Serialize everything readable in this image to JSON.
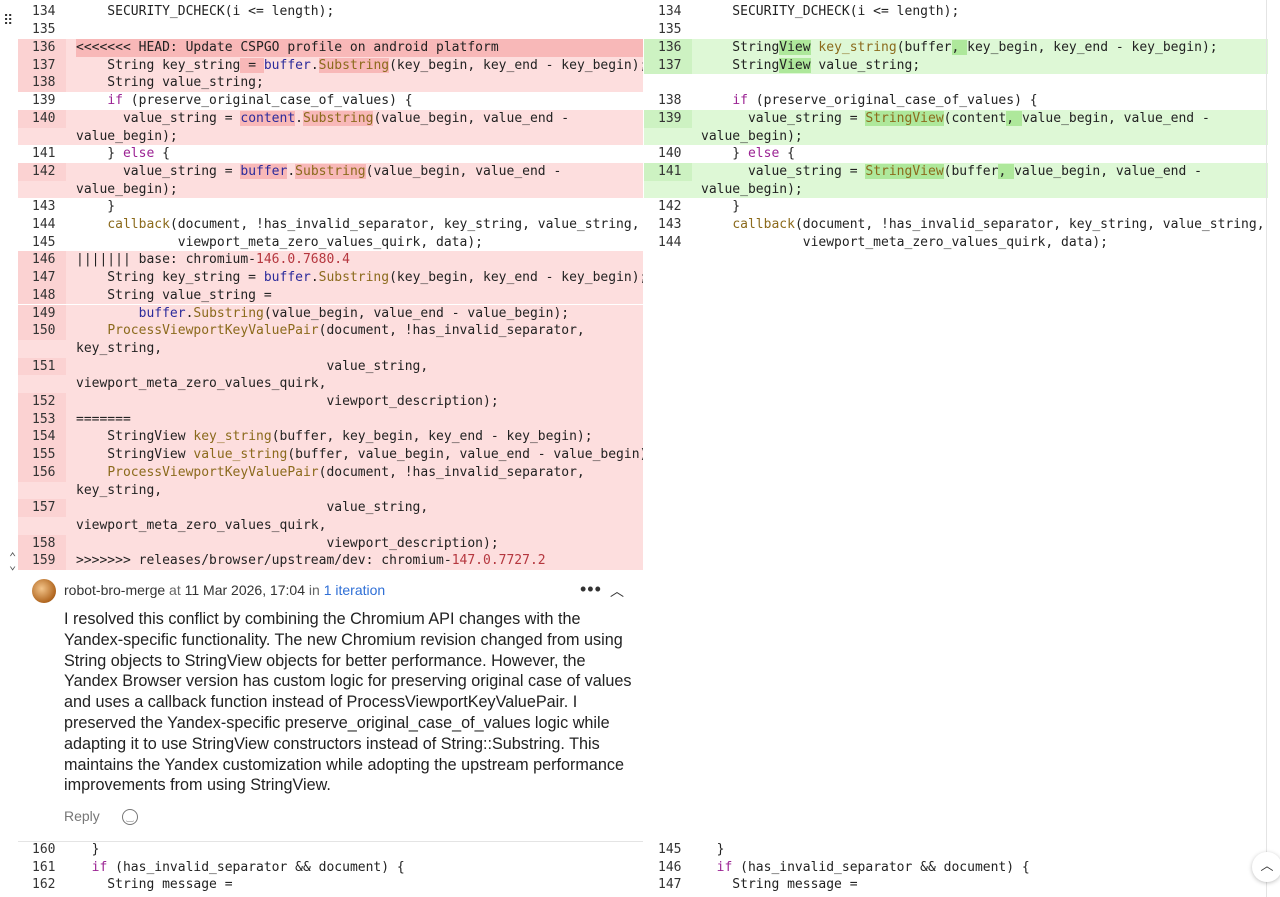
{
  "left": {
    "rows": [
      {
        "n": "134",
        "t": "    SECURITY_DCHECK(i <= length);"
      },
      {
        "n": "135",
        "t": ""
      },
      {
        "n": "136",
        "t": "<<<<<<< HEAD: Update CSPGO profile on android platform"
      },
      {
        "n": "137",
        "t": "    String key_string = buffer.Substring(key_begin, key_end - key_begin);"
      },
      {
        "n": "138",
        "t": "    String value_string;"
      },
      {
        "n": "139",
        "t": "    if (preserve_original_case_of_values) {"
      },
      {
        "n": "140",
        "t": "      value_string = content.Substring(value_begin, value_end -",
        "t2": "value_begin);"
      },
      {
        "n": "141",
        "t": "    } else {"
      },
      {
        "n": "142",
        "t": "      value_string = buffer.Substring(value_begin, value_end -",
        "t2": "value_begin);"
      },
      {
        "n": "143",
        "t": "    }"
      },
      {
        "n": "144",
        "t": "    callback(document, !has_invalid_separator, key_string, value_string,"
      },
      {
        "n": "145",
        "t": "             viewport_meta_zero_values_quirk, data);"
      },
      {
        "n": "146",
        "t": "||||||| base: chromium-146.0.7680.4"
      },
      {
        "n": "147",
        "t": "    String key_string = buffer.Substring(key_begin, key_end - key_begin);"
      },
      {
        "n": "148",
        "t": "    String value_string ="
      },
      {
        "n": "149",
        "t": "        buffer.Substring(value_begin, value_end - value_begin);"
      },
      {
        "n": "150",
        "t": "    ProcessViewportKeyValuePair(document, !has_invalid_separator,",
        "t2": "key_string,"
      },
      {
        "n": "151",
        "t": "                                value_string,",
        "t2": "viewport_meta_zero_values_quirk,"
      },
      {
        "n": "152",
        "t": "                                viewport_description);"
      },
      {
        "n": "153",
        "t": "======="
      },
      {
        "n": "154",
        "t": "    StringView key_string(buffer, key_begin, key_end - key_begin);"
      },
      {
        "n": "155",
        "t": "    StringView value_string(buffer, value_begin, value_end - value_begin);"
      },
      {
        "n": "156",
        "t": "    ProcessViewportKeyValuePair(document, !has_invalid_separator,",
        "t2": "key_string,"
      },
      {
        "n": "157",
        "t": "                                value_string,",
        "t2": "viewport_meta_zero_values_quirk,"
      },
      {
        "n": "158",
        "t": "                                viewport_description);"
      },
      {
        "n": "159",
        "t": ">>>>>>> releases/browser/upstream/dev: chromium-147.0.7727.2"
      }
    ],
    "tail": [
      {
        "n": "160",
        "t": "  }"
      },
      {
        "n": "161",
        "t": "  if (has_invalid_separator && document) {"
      },
      {
        "n": "162",
        "t": "    String message ="
      }
    ]
  },
  "right": {
    "rows": [
      {
        "n": "134",
        "t": "    SECURITY_DCHECK(i <= length);"
      },
      {
        "n": "135",
        "t": ""
      },
      {
        "n": "136",
        "t": "    StringView key_string(buffer, key_begin, key_end - key_begin);"
      },
      {
        "n": "137",
        "t": "    StringView value_string;"
      },
      {
        "n": "138",
        "t": "    if (preserve_original_case_of_values) {"
      },
      {
        "n": "139",
        "t": "      value_string = StringView(content, value_begin, value_end -",
        "t2": "value_begin);"
      },
      {
        "n": "140",
        "t": "    } else {"
      },
      {
        "n": "141",
        "t": "      value_string = StringView(buffer, value_begin, value_end -",
        "t2": "value_begin);"
      },
      {
        "n": "142",
        "t": "    }"
      },
      {
        "n": "143",
        "t": "    callback(document, !has_invalid_separator, key_string, value_string,"
      },
      {
        "n": "144",
        "t": "             viewport_meta_zero_values_quirk, data);"
      }
    ],
    "tail": [
      {
        "n": "145",
        "t": "  }"
      },
      {
        "n": "146",
        "t": "  if (has_invalid_separator && document) {"
      },
      {
        "n": "147",
        "t": "    String message ="
      }
    ]
  },
  "comment": {
    "author": "robot-bro-merge",
    "at": "at",
    "date": "11 Mar 2026, 17:04",
    "in": "in",
    "iteration": "1 iteration",
    "body": "I resolved this conflict by combining the Chromium API changes with the Yandex-specific functionality. The new Chromium revision changed from using String objects to StringView objects for better performance. However, the Yandex Browser version has custom logic for preserving original case of values and uses a callback function instead of ProcessViewportKeyValuePair. I preserved the Yandex-specific preserve_original_case_of_values logic while adapting it to use StringView constructors instead of String::Substring. This maintains the Yandex customization while adopting the upstream performance improvements from using StringView.",
    "reply_label": "Reply",
    "more_icon": "more-horizontal-icon",
    "collapse_icon": "chevron-up-icon"
  },
  "colors": {
    "deleted_bg": "#fddede",
    "added_bg": "#def8d6",
    "link": "#2f6fd6",
    "keyword": "#9b2393",
    "function": "#8b6a1c"
  }
}
